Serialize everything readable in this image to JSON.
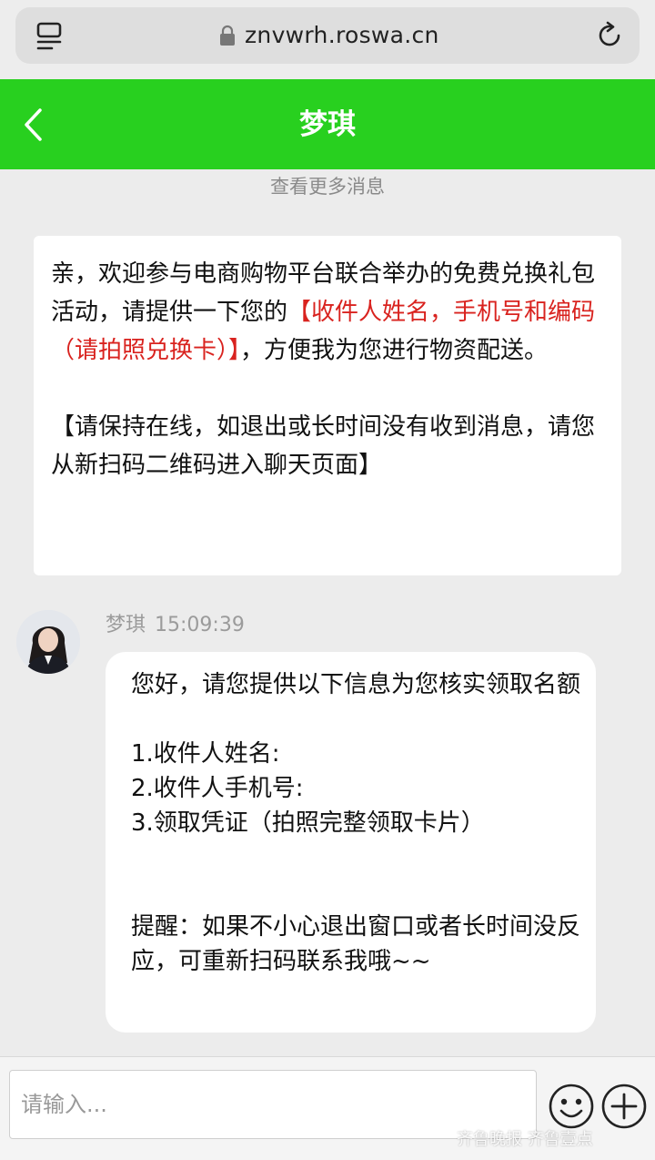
{
  "browser": {
    "url": "znvwrh.roswa.cn"
  },
  "header": {
    "title": "梦琪"
  },
  "more_messages": "查看更多消息",
  "welcome_card": {
    "part1": "亲，欢迎参与电商购物平台联合举办的免费兑换礼包活动，请提供一下您的",
    "red": "【收件人姓名，手机号和编码（请拍照兑换卡）】",
    "part2": "，方便我为您进行物资配送。",
    "notice": "【请保持在线，如退出或长时间没有收到消息，请您从新扫码二维码进入聊天页面】"
  },
  "message": {
    "sender": "梦琪",
    "time": "15:09:39",
    "lines": {
      "l1": "您好，请您提供以下信息为您核实领取名额",
      "l2": "1.收件人姓名:",
      "l3": "2.收件人手机号:",
      "l4": "3.领取凭证（拍照完整领取卡片）",
      "l5": "提醒：如果不小心退出窗口或者长时间没反应，可重新扫码联系我哦~~"
    }
  },
  "input": {
    "placeholder": "请输入..."
  },
  "watermark": "齐鲁晚报 齐鲁壹点",
  "colors": {
    "header_green": "#28d01f",
    "highlight_red": "#d9231f"
  }
}
